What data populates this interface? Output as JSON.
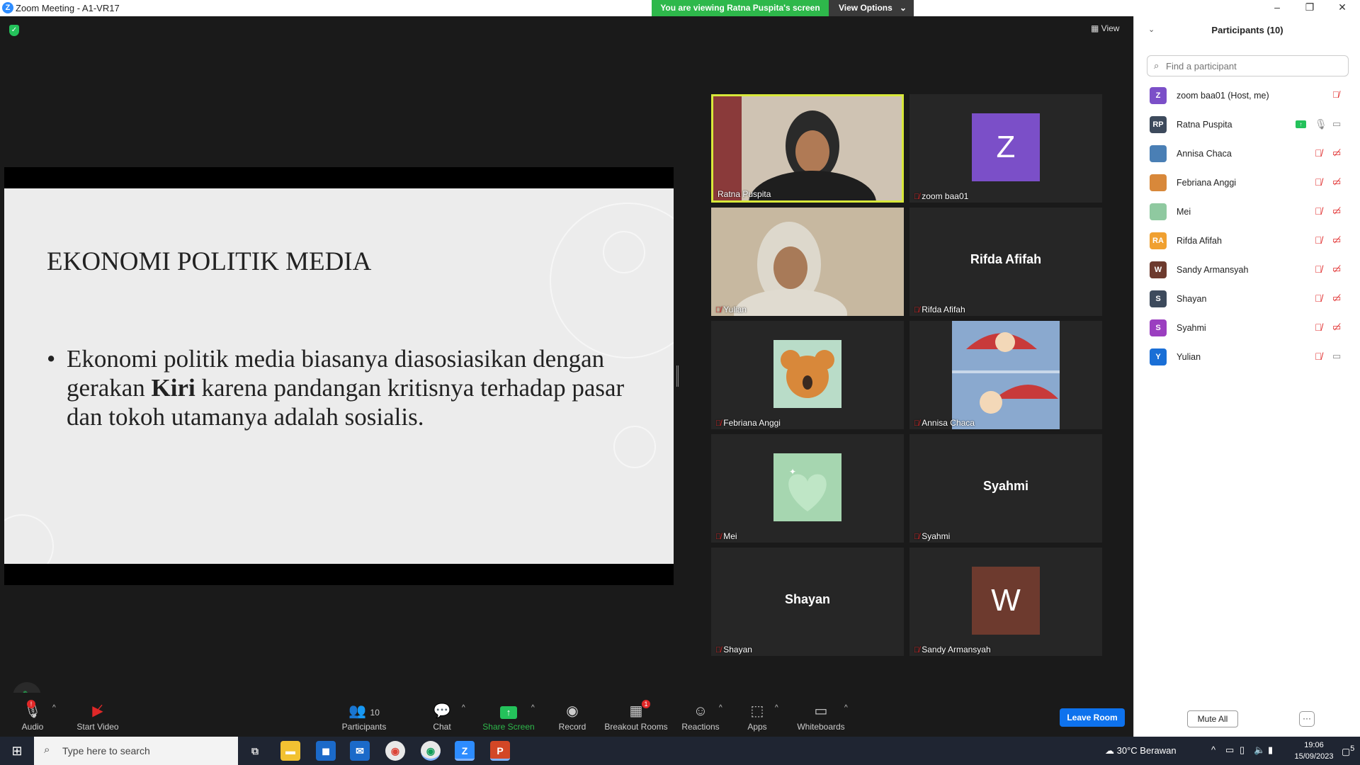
{
  "window": {
    "title": "Zoom Meeting - A1-VR17",
    "logo": "Z"
  },
  "share_banner": {
    "text": "You are viewing Ratna Puspita's screen",
    "options_label": "View Options"
  },
  "meeting": {
    "view_label": "View"
  },
  "slide": {
    "title": "EKONOMI POLITIK MEDIA",
    "bullet_pre": "Ekonomi politik media biasanya diasosiasikan dengan gerakan ",
    "bullet_bold": "Kiri",
    "bullet_post": " karena pandangan kritisnya terhadap pasar dan tokoh utamanya adalah sosialis."
  },
  "tiles": [
    {
      "name": "Ratna Puspita",
      "type": "video",
      "muted": false,
      "active": true
    },
    {
      "name": "zoom baa01",
      "type": "avatar",
      "initial": "Z",
      "color": "#7b4fc8",
      "muted": true
    },
    {
      "name": "Yulian",
      "type": "video",
      "muted": true
    },
    {
      "name": "Rifda Afifah",
      "type": "text",
      "muted": true
    },
    {
      "name": "Febriana Anggi",
      "type": "image",
      "muted": true
    },
    {
      "name": "Annisa Chaca",
      "type": "image",
      "muted": true
    },
    {
      "name": "Mei",
      "type": "image",
      "muted": true
    },
    {
      "name": "Syahmi",
      "type": "text",
      "muted": true
    },
    {
      "name": "Shayan",
      "type": "text",
      "muted": true
    },
    {
      "name": "Sandy Armansyah",
      "type": "avatar",
      "initial": "W",
      "color": "#6d3a2e",
      "muted": true
    }
  ],
  "toolbar": {
    "audio": "Audio",
    "audio_badge": "!",
    "start_video": "Start Video",
    "participants": "Participants",
    "participants_count": "10",
    "chat": "Chat",
    "share_screen": "Share Screen",
    "record": "Record",
    "breakout": "Breakout Rooms",
    "breakout_badge": "1",
    "reactions": "Reactions",
    "apps": "Apps",
    "whiteboards": "Whiteboards",
    "leave": "Leave Room"
  },
  "panel": {
    "title": "Participants (10)",
    "search_placeholder": "Find a participant",
    "participants": [
      {
        "name": "zoom baa01 (Host, me)",
        "initials": "Z",
        "color": "#7b4fc8",
        "mic": "muted",
        "cam": "none"
      },
      {
        "name": "Ratna Puspita",
        "initials": "RP",
        "color": "#3d4a5c",
        "mic": "on",
        "cam": "on",
        "sharing": true
      },
      {
        "name": "Annisa Chaca",
        "initials": "",
        "color": "#4a7fb5",
        "mic": "muted",
        "cam": "off"
      },
      {
        "name": "Febriana Anggi",
        "initials": "",
        "color": "#d8883a",
        "mic": "muted",
        "cam": "off"
      },
      {
        "name": "Mei",
        "initials": "",
        "color": "#8fc9a0",
        "mic": "muted",
        "cam": "off"
      },
      {
        "name": "Rifda Afifah",
        "initials": "RA",
        "color": "#f0a030",
        "mic": "muted",
        "cam": "off"
      },
      {
        "name": "Sandy Armansyah",
        "initials": "W",
        "color": "#6d3a2e",
        "mic": "muted",
        "cam": "off"
      },
      {
        "name": "Shayan",
        "initials": "S",
        "color": "#3d4a5c",
        "mic": "muted",
        "cam": "off"
      },
      {
        "name": "Syahmi",
        "initials": "S",
        "color": "#9b3fc0",
        "mic": "muted",
        "cam": "off"
      },
      {
        "name": "Yulian",
        "initials": "Y",
        "color": "#1a6fd6",
        "mic": "muted",
        "cam": "on"
      }
    ],
    "mute_all": "Mute All",
    "more": "···"
  },
  "taskbar": {
    "search_placeholder": "Type here to search",
    "weather": "30°C  Berawan",
    "time": "19:06",
    "date": "15/09/2023",
    "notif_count": "5"
  }
}
